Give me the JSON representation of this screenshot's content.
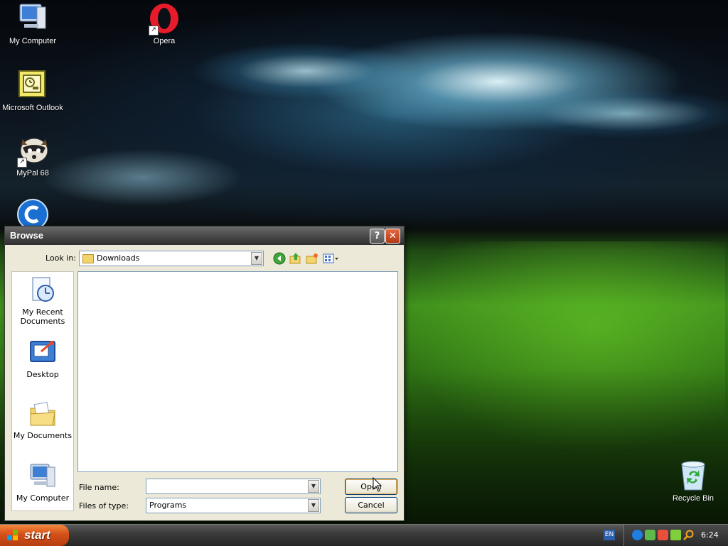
{
  "desktop": {
    "icons": [
      {
        "label": "My Computer",
        "icon": "computer-icon"
      },
      {
        "label": "Opera",
        "icon": "opera-icon"
      },
      {
        "label": "Microsoft Outlook",
        "icon": "outlook-icon"
      },
      {
        "label": "MyPal 68",
        "icon": "mypal-icon"
      },
      {
        "label": "Recycle Bin",
        "icon": "recycle-bin-icon"
      }
    ]
  },
  "dialog": {
    "title": "Browse",
    "look_in_label": "Look in:",
    "look_in_value": "Downloads",
    "places": [
      {
        "label": "My Recent Documents",
        "icon": "recent-documents-icon"
      },
      {
        "label": "Desktop",
        "icon": "desktop-icon"
      },
      {
        "label": "My Documents",
        "icon": "my-documents-icon"
      },
      {
        "label": "My Computer",
        "icon": "computer-icon"
      }
    ],
    "file_name_label": "File name:",
    "file_name_value": "",
    "file_type_label": "Files of type:",
    "file_type_value": "Programs",
    "open_label": "Open",
    "cancel_label": "Cancel"
  },
  "taskbar": {
    "start_label": "start",
    "language": "EN",
    "clock": "6:24"
  },
  "colors": {
    "dialog_bg": "#ece9d8",
    "start_orange": "#d4501a",
    "titlebar_dark": "#4d4d4d"
  }
}
